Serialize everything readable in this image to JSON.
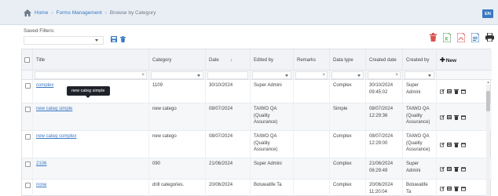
{
  "breadcrumb": {
    "home": "Home",
    "section": "Forms Management",
    "current": "Browse by Category",
    "separator": "›"
  },
  "language_badge": "EN",
  "saved_filters": {
    "label": "Saved Filters:",
    "value": ""
  },
  "columns": {
    "title": "Title",
    "category": "Category",
    "date": "Date",
    "edited_by": "Edited by",
    "remarks": "Remarks",
    "data_type": "Data type",
    "created_date": "Created date",
    "created_by": "Created by",
    "new": "New"
  },
  "tooltip": "new categ simple",
  "rows": [
    {
      "title": "complex",
      "category": "1109",
      "date": "30/10/2024",
      "edited_by": "Super Admini",
      "remarks": "",
      "data_type": "Complex",
      "created_date": "30/10/2024 09:45:02",
      "created_by": "Super Admini"
    },
    {
      "title": "new categ simple",
      "category": "new catego",
      "date": "08/07/2024",
      "edited_by": "TAIWO QA (Quality Assurance)",
      "remarks": "",
      "data_type": "Simple",
      "created_date": "08/07/2024 12:29:36",
      "created_by": "TAIWO QA (Quality Assurance)"
    },
    {
      "title": "new categ complex",
      "category": "new catego",
      "date": "08/07/2024",
      "edited_by": "TAIWO QA (Quality Assurance)",
      "remarks": "",
      "data_type": "Complex",
      "created_date": "08/07/2024 12:29:00",
      "created_by": "TAIWO QA (Quality Assurance)"
    },
    {
      "title": "2106",
      "category": "090",
      "date": "21/06/2024",
      "edited_by": "Super Admini",
      "remarks": "",
      "data_type": "Complex",
      "created_date": "21/06/2024 06:29:49",
      "created_by": "Super Admini"
    },
    {
      "title": "none",
      "category": "drill categories.",
      "date": "20/06/2024",
      "edited_by": "Boluwatife Ta",
      "remarks": "",
      "data_type": "Complex",
      "created_date": "20/06/2024 11:20:04",
      "created_by": "Boluwatife Ta"
    }
  ],
  "colors": {
    "link": "#3a78c2",
    "badge": "#3a78c2",
    "delete": "#d9534f",
    "excel": "#4a9d4a",
    "pdf": "#d9534f",
    "doc": "#3a78c2"
  },
  "icons": [
    "home-icon",
    "save-filter-icon",
    "delete-filter-icon",
    "delete-icon",
    "excel-icon",
    "pdf-icon",
    "doc-icon",
    "print-icon",
    "sort-icon",
    "edit-icon",
    "view-icon",
    "trash-icon",
    "calendar-icon"
  ]
}
